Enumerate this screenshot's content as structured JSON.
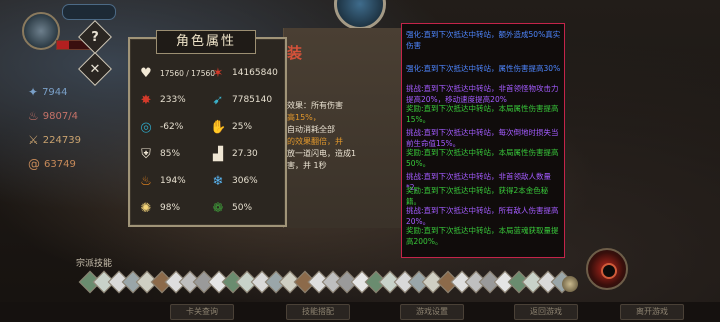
{
  "hud": {
    "top_capsule_text": "",
    "hp_fraction": 0.3,
    "left_stats": [
      {
        "icon": "blue-feather-icon",
        "value": "7944",
        "color": "#7aa0c8"
      },
      {
        "icon": "red-flame-icon",
        "value": "9807/4",
        "color": "#c57268"
      },
      {
        "icon": "orange-sword-icon",
        "value": "224739",
        "color": "#c9a26f"
      },
      {
        "icon": "spiral-icon",
        "value": "63749",
        "color": "#c78a59"
      }
    ]
  },
  "stats_panel": {
    "title": "角色属性",
    "rows": [
      {
        "left": {
          "icon": "heart-icon",
          "value": "17560 / 17560"
        },
        "right": {
          "icon": "red-attack-icon",
          "value": "14165840"
        }
      },
      {
        "left": {
          "icon": "crit-rate-icon",
          "value": "233%"
        },
        "right": {
          "icon": "crit-damage-icon",
          "value": "7785140"
        }
      },
      {
        "left": {
          "icon": "blue-ring-icon",
          "value": "-62%"
        },
        "right": {
          "icon": "claw-icon",
          "value": "25%"
        }
      },
      {
        "left": {
          "icon": "shield-icon",
          "value": "85%"
        },
        "right": {
          "icon": "boot-icon",
          "value": "27.30"
        }
      },
      {
        "left": {
          "icon": "fire-icon",
          "value": "194%"
        },
        "right": {
          "icon": "snowflake-icon",
          "value": "306%"
        }
      },
      {
        "left": {
          "icon": "gold-spark-icon",
          "value": "98%"
        },
        "right": {
          "icon": "green-orb-icon",
          "value": "50%"
        }
      }
    ]
  },
  "scroll": {
    "title": "装",
    "lines": [
      "效果：所有伤害",
      "高15%，",
      "自动消耗全部",
      "的效果翻倍，并",
      "放一道闪电，造成1",
      "害，并        1秒"
    ]
  },
  "tooltip": {
    "blocks": [
      {
        "label": "强化:",
        "label_color": "blue",
        "lines": [
          "直到下次抵达中转站，额外造成50%真实伤害"
        ]
      },
      {
        "label": "强化:",
        "label_color": "blue",
        "lines": [
          "直到下次抵达中转站，属性伤害提高30%"
        ]
      },
      {
        "label": "挑战:",
        "label_color": "purple",
        "lines": [
          "直到下次抵达中转站，非首领怪物攻击力提高20%，移动速度提高20%"
        ]
      },
      {
        "label": "奖励:",
        "label_color": "green",
        "lines": [
          "直到下次抵达中转站，本局属性伤害提高15%。"
        ]
      },
      {
        "label": "挑战:",
        "label_color": "purple",
        "lines": [
          "直到下次抵达中转站，每次倒地时损失当前生命值15%。"
        ]
      },
      {
        "label": "奖励:",
        "label_color": "green",
        "lines": [
          "直到下次抵达中转站，本局属性伤害提高50%。"
        ]
      },
      {
        "label": "挑战:",
        "label_color": "purple",
        "lines": [
          "直到下次抵达中转站，非首领敌人数量*2。"
        ]
      },
      {
        "label": "奖励:",
        "label_color": "green",
        "lines": [
          "直到下次抵达中转站，获得2本金色秘籍。"
        ]
      },
      {
        "label": "挑战:",
        "label_color": "purple",
        "lines": [
          "直到下次抵达中转站，所有敌人伤害提高20%。"
        ]
      },
      {
        "label": "奖励:",
        "label_color": "green",
        "lines": [
          "直到下次抵达中转站，本局蓝魂获取量提高200%。"
        ]
      }
    ]
  },
  "skills": {
    "label": "宗派技能",
    "count": 34
  },
  "bottom_buttons": [
    "卡关查询",
    "技能搭配",
    "游戏设置",
    "返回游戏",
    "离开游戏"
  ],
  "icons": {
    "help": "?",
    "close": "✕"
  }
}
